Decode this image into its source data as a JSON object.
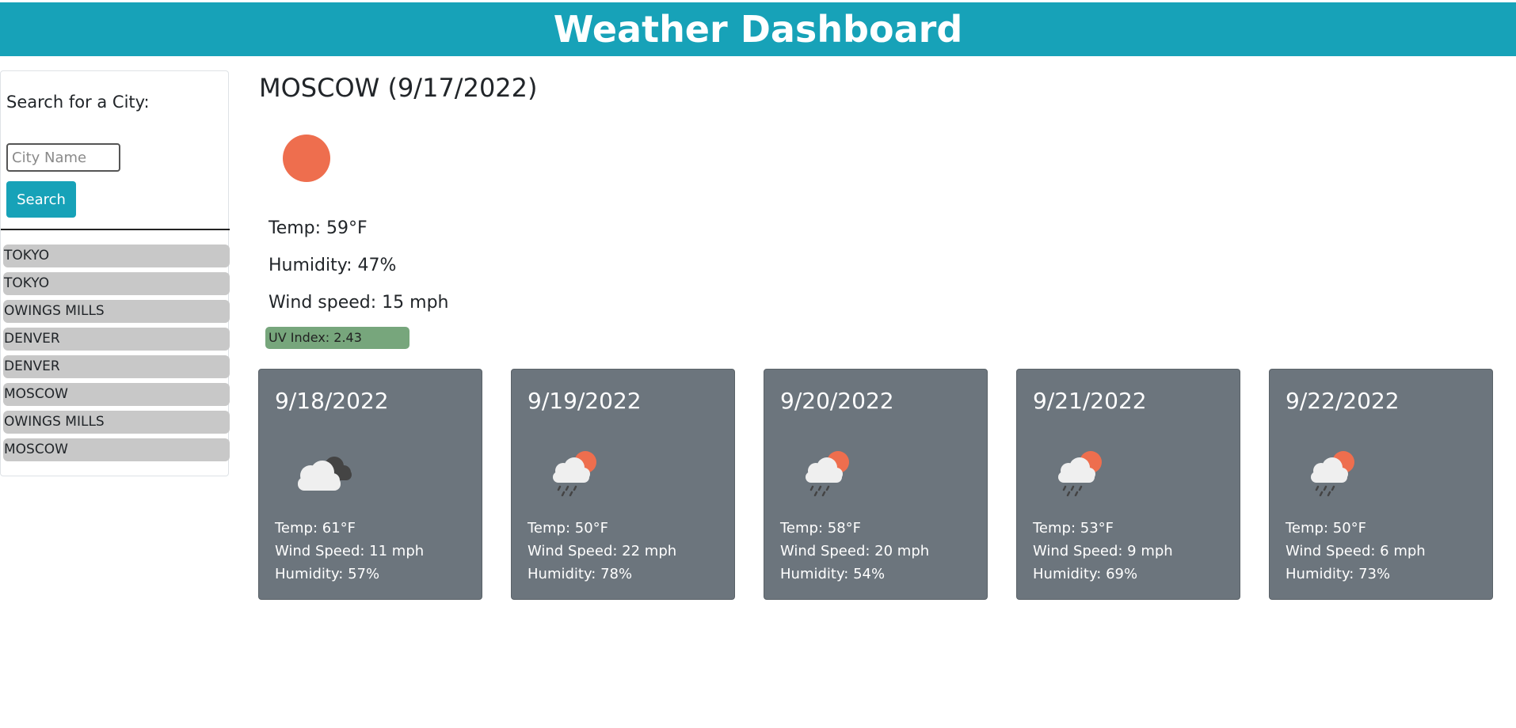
{
  "header": {
    "title": "Weather Dashboard"
  },
  "sidebar": {
    "heading": "Search for a City:",
    "input_placeholder": "City Name",
    "input_value": "",
    "search_label": "Search",
    "history": [
      "TOKYO",
      "TOKYO",
      "OWINGS MILLS",
      "DENVER",
      "DENVER",
      "MOSCOW",
      "OWINGS MILLS",
      "MOSCOW"
    ]
  },
  "current": {
    "title": "MOSCOW (9/17/2022)",
    "icon": "sun-icon",
    "temp": "Temp: 59°F",
    "humidity": "Humidity: 47%",
    "wind": "Wind speed: 15 mph",
    "uv": "UV Index: 2.43",
    "uv_color": "#77a67c"
  },
  "forecast": [
    {
      "date": "9/18/2022",
      "icon": "cloudy-icon",
      "temp": "Temp: 61°F",
      "wind": "Wind Speed: 11 mph",
      "humidity": "Humidity: 57%"
    },
    {
      "date": "9/19/2022",
      "icon": "rain-sun-icon",
      "temp": "Temp: 50°F",
      "wind": "Wind Speed: 22 mph",
      "humidity": "Humidity: 78%"
    },
    {
      "date": "9/20/2022",
      "icon": "rain-sun-icon",
      "temp": "Temp: 58°F",
      "wind": "Wind Speed: 20 mph",
      "humidity": "Humidity: 54%"
    },
    {
      "date": "9/21/2022",
      "icon": "rain-sun-icon",
      "temp": "Temp: 53°F",
      "wind": "Wind Speed: 9 mph",
      "humidity": "Humidity: 69%"
    },
    {
      "date": "9/22/2022",
      "icon": "rain-sun-icon",
      "temp": "Temp: 50°F",
      "wind": "Wind Speed: 6 mph",
      "humidity": "Humidity: 73%"
    }
  ],
  "colors": {
    "accent": "#17a2b8",
    "card_bg": "#6c757d",
    "sun": "#ee6e4e",
    "history_bg": "#c8c8c8"
  }
}
